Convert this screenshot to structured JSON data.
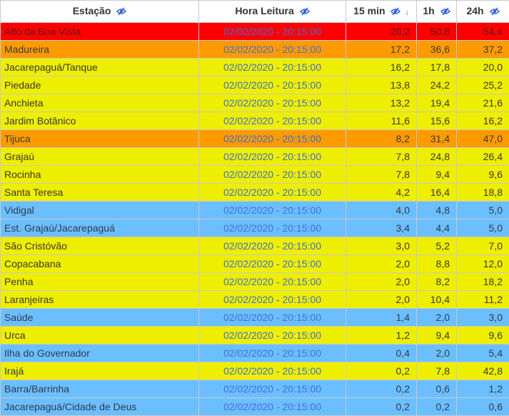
{
  "colors": {
    "red": "#ff0000",
    "orange": "#ff9a00",
    "yellow": "#eeee00",
    "blue": "#6cbfff",
    "time_text": "#3f6fd6",
    "icon": "#2a5fd6"
  },
  "columns": [
    {
      "label": "Estação",
      "icon": "eye-slash-icon"
    },
    {
      "label": "Hora Leitura",
      "icon": "eye-slash-icon"
    },
    {
      "label": "15 min",
      "icon": "eye-slash-icon",
      "sort": "down-arrow-icon"
    },
    {
      "label": "1h",
      "icon": "eye-slash-icon"
    },
    {
      "label": "24h",
      "icon": "eye-slash-icon"
    }
  ],
  "rows": [
    {
      "station": "Alto da Boa Vista",
      "time": "02/02/2020 - 20:15:00",
      "m15": "20,2",
      "h1": "50,8",
      "h24": "54,4",
      "level": "red"
    },
    {
      "station": "Madureira",
      "time": "02/02/2020 - 20:15:00",
      "m15": "17,2",
      "h1": "36,6",
      "h24": "37,2",
      "level": "orange"
    },
    {
      "station": "Jacarepaguá/Tanque",
      "time": "02/02/2020 - 20:15:00",
      "m15": "16,2",
      "h1": "17,8",
      "h24": "20,0",
      "level": "yellow"
    },
    {
      "station": "Piedade",
      "time": "02/02/2020 - 20:15:00",
      "m15": "13,8",
      "h1": "24,2",
      "h24": "25,2",
      "level": "yellow"
    },
    {
      "station": "Anchieta",
      "time": "02/02/2020 - 20:15:00",
      "m15": "13,2",
      "h1": "19,4",
      "h24": "21,6",
      "level": "yellow"
    },
    {
      "station": "Jardim Botânico",
      "time": "02/02/2020 - 20:15:00",
      "m15": "11,6",
      "h1": "15,6",
      "h24": "16,2",
      "level": "yellow"
    },
    {
      "station": "Tijuca",
      "time": "02/02/2020 - 20:15:00",
      "m15": "8,2",
      "h1": "31,4",
      "h24": "47,0",
      "level": "orange"
    },
    {
      "station": "Grajaú",
      "time": "02/02/2020 - 20:15:00",
      "m15": "7,8",
      "h1": "24,8",
      "h24": "26,4",
      "level": "yellow"
    },
    {
      "station": "Rocinha",
      "time": "02/02/2020 - 20:15:00",
      "m15": "7,8",
      "h1": "9,4",
      "h24": "9,6",
      "level": "yellow"
    },
    {
      "station": "Santa Teresa",
      "time": "02/02/2020 - 20:15:00",
      "m15": "4,2",
      "h1": "16,4",
      "h24": "18,8",
      "level": "yellow"
    },
    {
      "station": "Vidigal",
      "time": "02/02/2020 - 20:15:00",
      "m15": "4,0",
      "h1": "4,8",
      "h24": "5,0",
      "level": "blue"
    },
    {
      "station": "Est. Grajaú/Jacarepaguá",
      "time": "02/02/2020 - 20:15:00",
      "m15": "3,4",
      "h1": "4,4",
      "h24": "5,0",
      "level": "blue"
    },
    {
      "station": "São Cristóvão",
      "time": "02/02/2020 - 20:15:00",
      "m15": "3,0",
      "h1": "5,2",
      "h24": "7,0",
      "level": "yellow"
    },
    {
      "station": "Copacabana",
      "time": "02/02/2020 - 20:15:00",
      "m15": "2,0",
      "h1": "8,8",
      "h24": "12,0",
      "level": "yellow"
    },
    {
      "station": "Penha",
      "time": "02/02/2020 - 20:15:00",
      "m15": "2,0",
      "h1": "8,2",
      "h24": "18,2",
      "level": "yellow"
    },
    {
      "station": "Laranjeiras",
      "time": "02/02/2020 - 20:15:00",
      "m15": "2,0",
      "h1": "10,4",
      "h24": "11,2",
      "level": "yellow"
    },
    {
      "station": "Saúde",
      "time": "02/02/2020 - 20:15:00",
      "m15": "1,4",
      "h1": "2,0",
      "h24": "3,0",
      "level": "blue"
    },
    {
      "station": "Urca",
      "time": "02/02/2020 - 20:15:00",
      "m15": "1,2",
      "h1": "9,4",
      "h24": "9,6",
      "level": "yellow"
    },
    {
      "station": "Ilha do Governador",
      "time": "02/02/2020 - 20:15:00",
      "m15": "0,4",
      "h1": "2,0",
      "h24": "5,4",
      "level": "blue"
    },
    {
      "station": "Irajá",
      "time": "02/02/2020 - 20:15:00",
      "m15": "0,2",
      "h1": "7,8",
      "h24": "42,8",
      "level": "yellow"
    },
    {
      "station": "Barra/Barrinha",
      "time": "02/02/2020 - 20:15:00",
      "m15": "0,2",
      "h1": "0,6",
      "h24": "1,2",
      "level": "blue"
    },
    {
      "station": "Jacarepaguá/Cidade de Deus",
      "time": "02/02/2020 - 20:15:00",
      "m15": "0,2",
      "h1": "0,2",
      "h24": "0,6",
      "level": "blue"
    }
  ]
}
